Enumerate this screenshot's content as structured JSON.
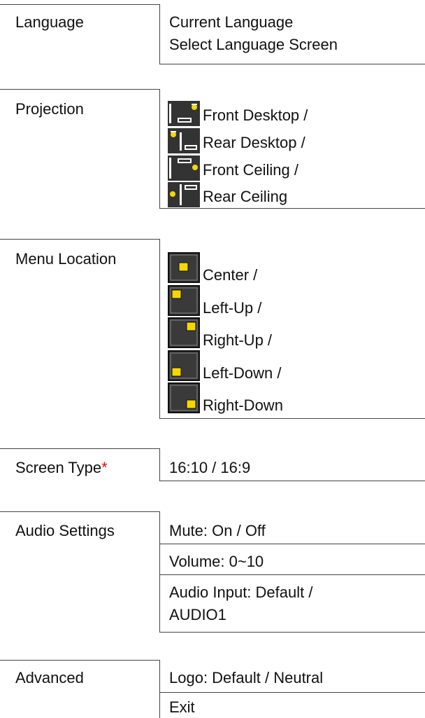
{
  "language": {
    "label": "Language",
    "values": [
      "Current Language",
      "Select Language Screen"
    ]
  },
  "projection": {
    "label": "Projection",
    "options": [
      {
        "icon": "front-desktop-icon",
        "text": "Front Desktop /"
      },
      {
        "icon": "rear-desktop-icon",
        "text": "Rear Desktop /"
      },
      {
        "icon": "front-ceiling-icon",
        "text": "Front Ceiling /"
      },
      {
        "icon": "rear-ceiling-icon",
        "text": "Rear Ceiling"
      }
    ]
  },
  "menu_location": {
    "label": "Menu Location",
    "options": [
      {
        "icon": "menu-center-icon",
        "text": "Center /"
      },
      {
        "icon": "menu-left-up-icon",
        "text": "Left-Up /"
      },
      {
        "icon": "menu-right-up-icon",
        "text": "Right-Up /"
      },
      {
        "icon": "menu-left-down-icon",
        "text": "Left-Down /"
      },
      {
        "icon": "menu-right-down-icon",
        "text": "Right-Down"
      }
    ]
  },
  "screen_type": {
    "label": "Screen Type",
    "asterisk": "*",
    "value": "16:10 / 16:9"
  },
  "audio_settings": {
    "label": "Audio Settings",
    "rows": [
      "Mute: On / Off",
      "Volume: 0~10",
      "Audio Input: Default /",
      "AUDIO1"
    ]
  },
  "advanced": {
    "label": "Advanced",
    "rows": [
      "Logo: Default / Neutral",
      "Exit"
    ]
  },
  "colors": {
    "asterisk": "#dd1111",
    "icon_dark": "#333333",
    "icon_yellow": "#f5d800"
  }
}
